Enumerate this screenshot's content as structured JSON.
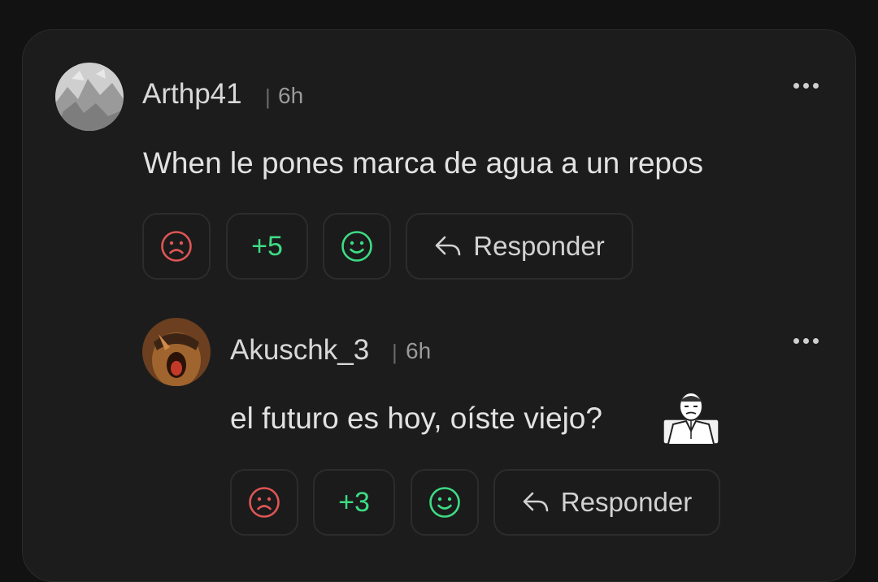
{
  "comment": {
    "username": "Arthp41",
    "separator": "|",
    "time": "6h",
    "text": "When le pones marca de agua a un repos",
    "score": "+5",
    "reply_label": "Responder",
    "icons": {
      "downvote": "sad-face-icon",
      "upvote": "smile-face-icon",
      "reply": "reply-arrow-icon",
      "more": "more-dots-icon"
    }
  },
  "reply": {
    "username": "Akuschk_3",
    "separator": "|",
    "time": "6h",
    "text": "el futuro es hoy, oíste viejo?",
    "score": "+3",
    "reply_label": "Responder",
    "icons": {
      "downvote": "sad-face-icon",
      "upvote": "smile-face-icon",
      "reply": "reply-arrow-icon",
      "more": "more-dots-icon",
      "sticker": "meme-sticker-icon"
    }
  },
  "colors": {
    "background": "#121212",
    "card": "#1c1c1c",
    "upvote": "#3ddc84",
    "downvote": "#e05555",
    "text": "#e2e2e2"
  }
}
